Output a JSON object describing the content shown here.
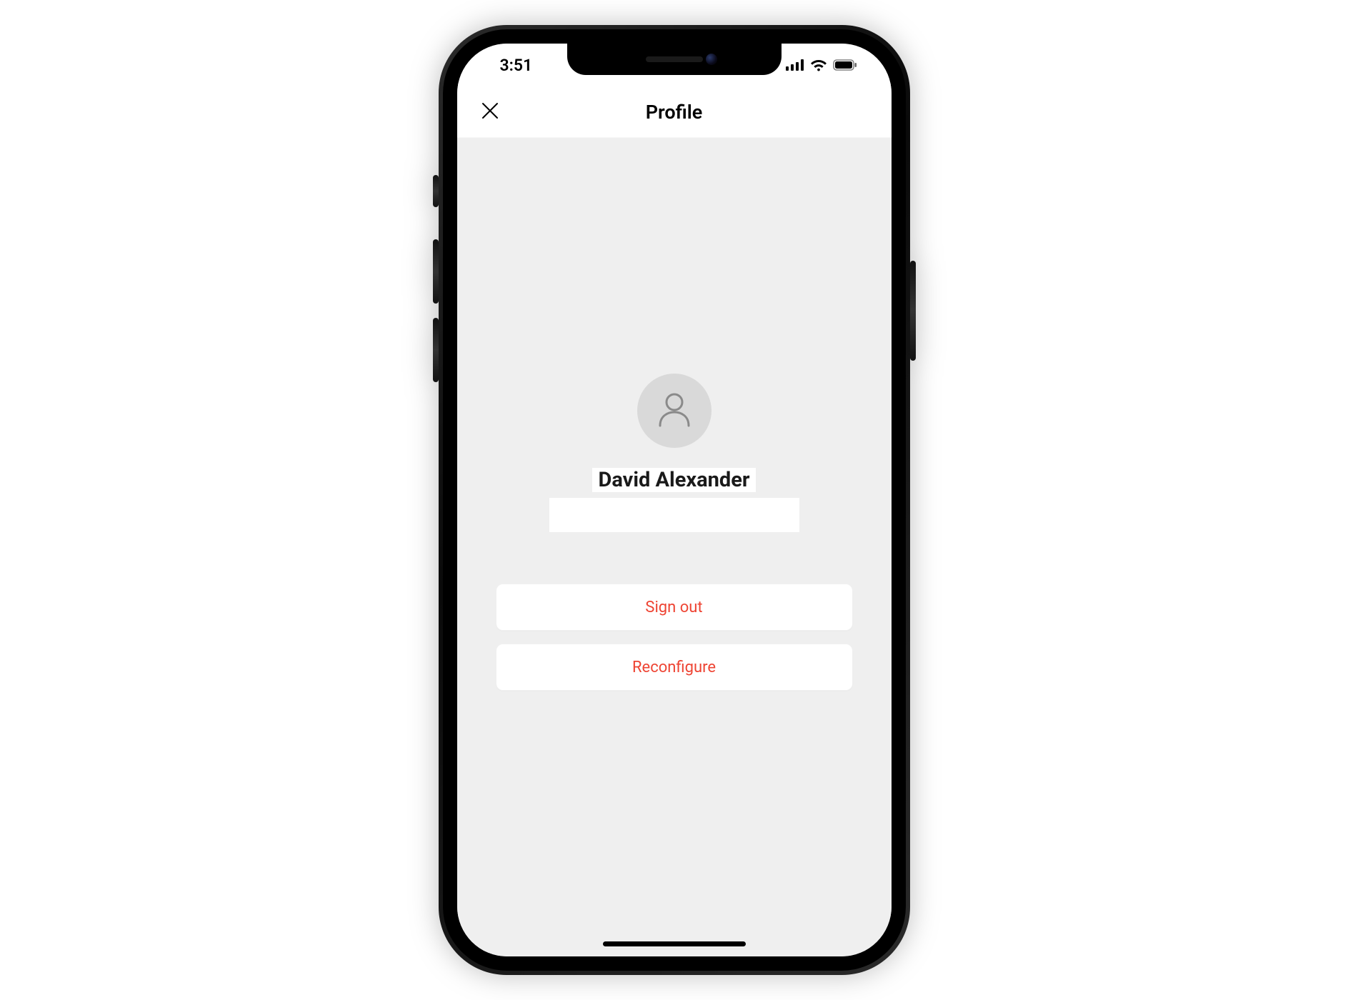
{
  "status": {
    "time": "3:51"
  },
  "nav": {
    "title": "Profile"
  },
  "profile": {
    "name": "David Alexander"
  },
  "actions": {
    "sign_out": "Sign out",
    "reconfigure": "Reconfigure"
  },
  "colors": {
    "danger": "#ee4433",
    "screen_bg": "#efefef",
    "avatar_bg": "#d9d9d9"
  }
}
